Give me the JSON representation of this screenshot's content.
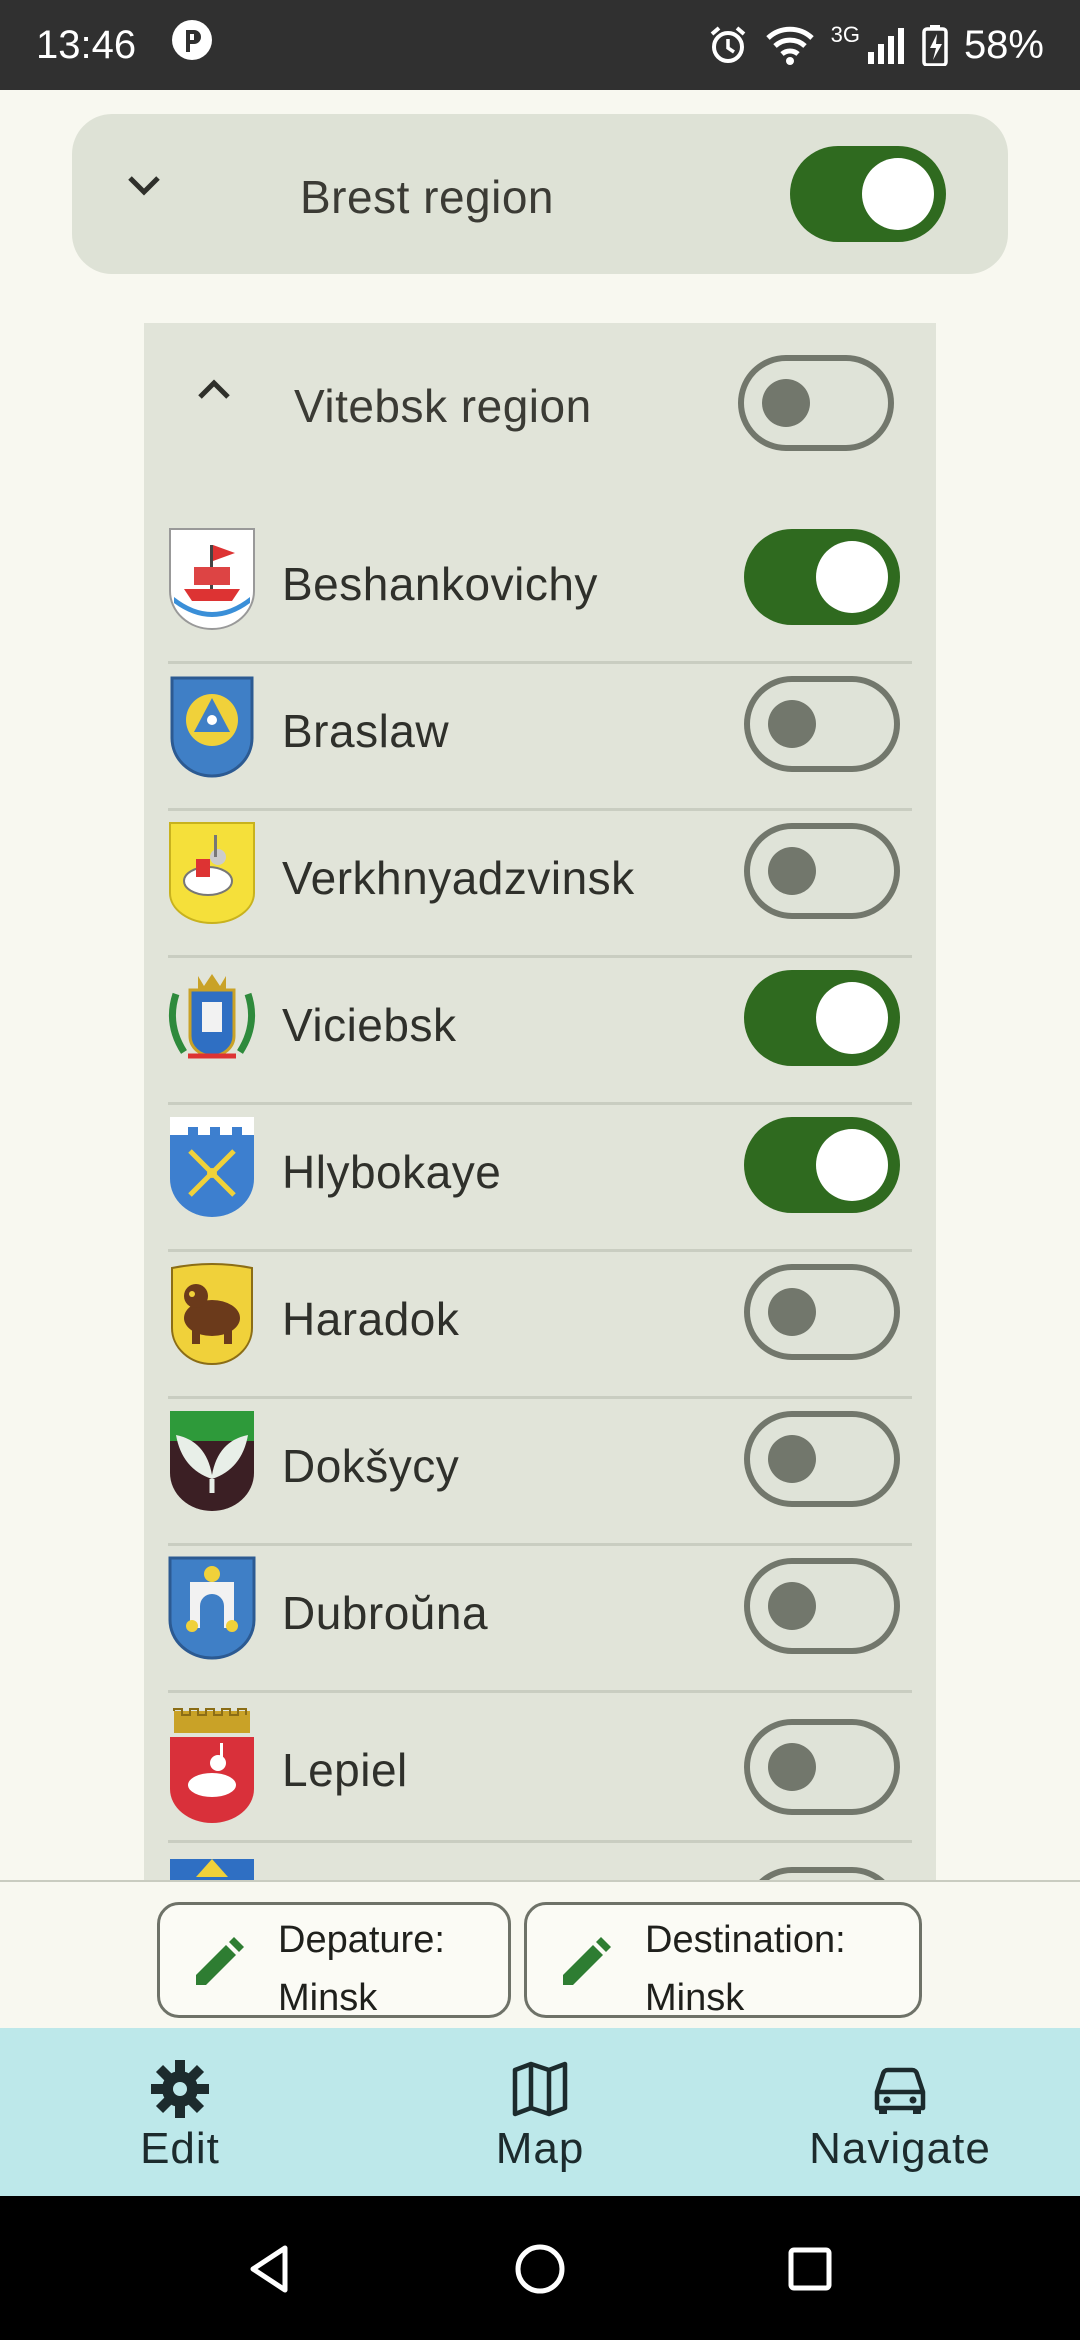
{
  "status_bar": {
    "time": "13:46",
    "network_label": "3G",
    "battery": "58%",
    "icons": [
      "app-notification-icon",
      "alarm-icon",
      "wifi-icon",
      "signal-icon",
      "battery-charging-icon"
    ]
  },
  "regions": [
    {
      "label": "Brest region",
      "expanded": false,
      "enabled": true
    },
    {
      "label": "Vitebsk region",
      "expanded": true,
      "enabled": false
    }
  ],
  "cities": [
    {
      "label": "Beshankovichy",
      "enabled": true,
      "crest": "beshankovichy-crest-icon"
    },
    {
      "label": "Braslaw",
      "enabled": false,
      "crest": "braslaw-crest-icon"
    },
    {
      "label": "Verkhnyadzvinsk",
      "enabled": false,
      "crest": "verkhnyadzvinsk-crest-icon"
    },
    {
      "label": "Viciebsk",
      "enabled": true,
      "crest": "viciebsk-crest-icon"
    },
    {
      "label": "Hlybokaye",
      "enabled": true,
      "crest": "hlybokaye-crest-icon"
    },
    {
      "label": "Haradok",
      "enabled": false,
      "crest": "haradok-crest-icon"
    },
    {
      "label": "Dokšycy",
      "enabled": false,
      "crest": "doksycy-crest-icon"
    },
    {
      "label": "Dubroŭna",
      "enabled": false,
      "crest": "dubrouna-crest-icon"
    },
    {
      "label": "Lepiel",
      "enabled": false,
      "crest": "lepiel-crest-icon"
    }
  ],
  "route": {
    "departure_label": "Depature:",
    "departure_value": "Minsk",
    "destination_label": "Destination:",
    "destination_value": "Minsk"
  },
  "bottom_nav": {
    "edit": "Edit",
    "map": "Map",
    "navigate": "Navigate"
  },
  "colors": {
    "switch_on": "#2f6a1f",
    "switch_off_outline": "#72776c",
    "panel_bg": "#e1e4d9",
    "nav_bg": "#bde8ea"
  }
}
